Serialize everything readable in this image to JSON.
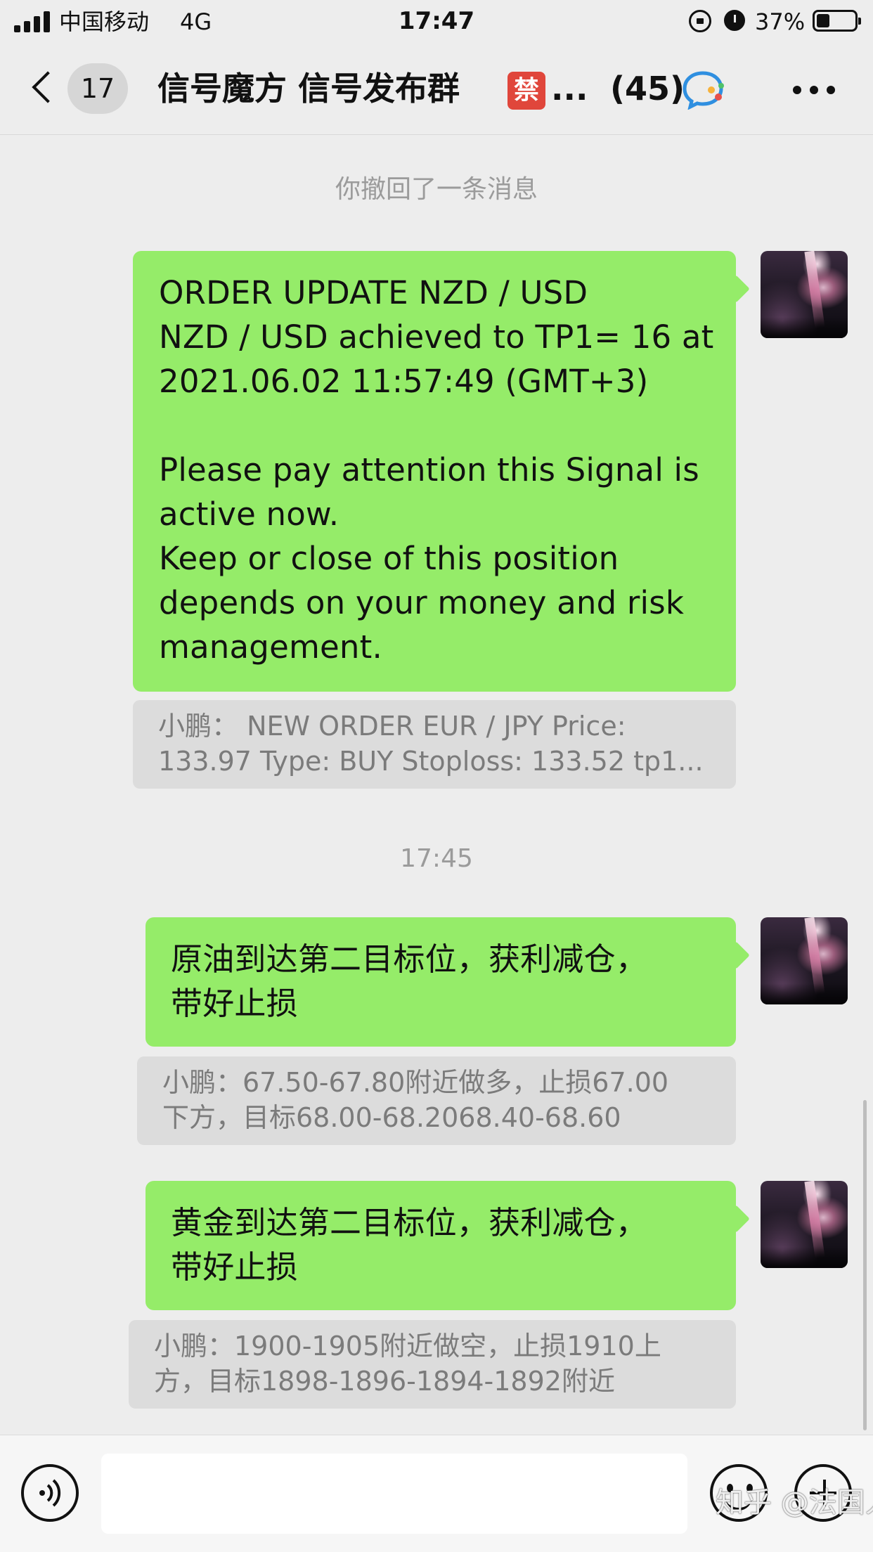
{
  "status_bar": {
    "carrier": "中国移动",
    "network": "4G",
    "time": "17:47",
    "battery": "37%"
  },
  "nav": {
    "unread_count": "17",
    "title": "信号魔方 信号发布群",
    "badge": "禁",
    "ellipsis": "...",
    "member_count": "(45)"
  },
  "chat": {
    "system_notice": "你撤回了一条消息",
    "timestamp": "17:45",
    "messages": [
      {
        "lines": [
          "ORDER UPDATE NZD / USD",
          "NZD / USD achieved to TP1= 16 at",
          " 2021.06.02 11:57:49 (GMT+3)",
          "",
          "Please pay attention this Signal is",
          "active now.",
          "Keep or close of this position",
          "depends on your money and risk",
          "management."
        ],
        "quote_lines": [
          "小鹏： NEW ORDER EUR / JPY Price:",
          "133.97 Type: BUY Stoploss: 133.52 tp1..."
        ]
      },
      {
        "lines": [
          "原油到达第二目标位，获利减仓，",
          "带好止损"
        ],
        "quote_lines": [
          "小鹏：67.50-67.80附近做多，止损67.00",
          "下方，目标68.00-68.2068.40-68.60"
        ]
      },
      {
        "lines": [
          "黄金到达第二目标位，获利减仓，",
          "带好止损"
        ],
        "quote_lines": [
          "小鹏：1900-1905附近做空，止损1910上",
          "方，目标1898-1896-1894-1892附近"
        ]
      }
    ]
  },
  "input": {
    "placeholder": ""
  },
  "watermark": "知乎 @法国人"
}
